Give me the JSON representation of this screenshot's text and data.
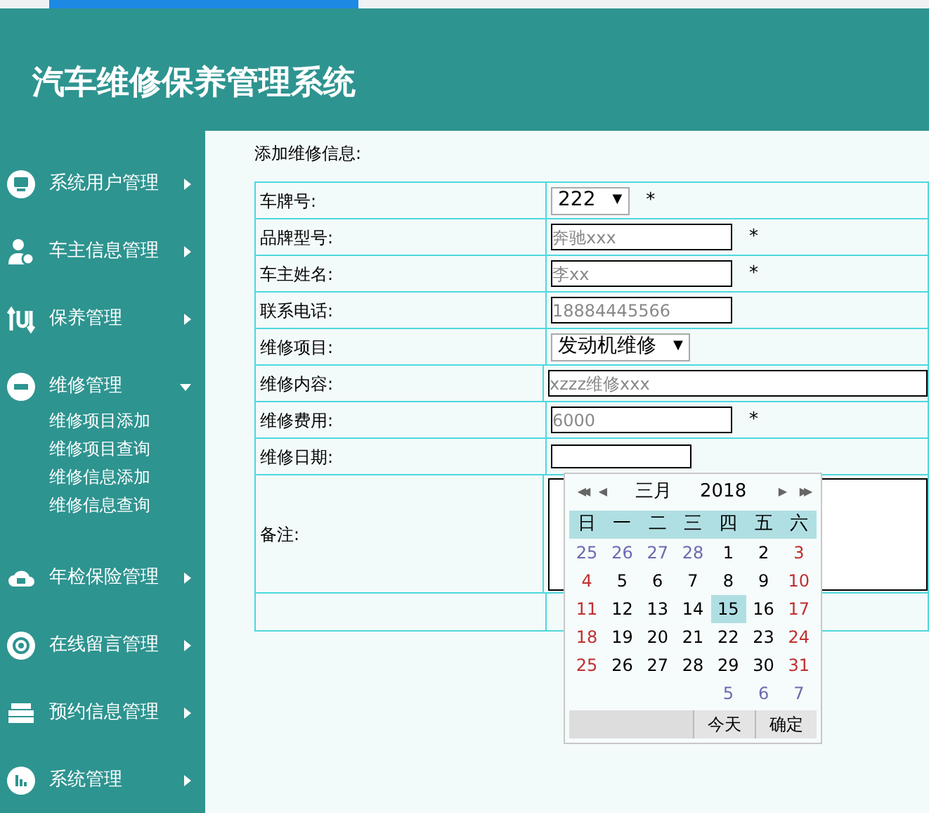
{
  "header": {
    "title": "汽车维修保养管理系统"
  },
  "sidebar": {
    "items": [
      {
        "label": "系统用户管理",
        "expanded": false
      },
      {
        "label": "车主信息管理",
        "expanded": false
      },
      {
        "label": "保养管理",
        "expanded": false
      },
      {
        "label": "维修管理",
        "expanded": true,
        "children": [
          {
            "label": "维修项目添加"
          },
          {
            "label": "维修项目查询"
          },
          {
            "label": "维修信息添加"
          },
          {
            "label": "维修信息查询"
          }
        ]
      },
      {
        "label": "年检保险管理",
        "expanded": false
      },
      {
        "label": "在线留言管理",
        "expanded": false
      },
      {
        "label": "预约信息管理",
        "expanded": false
      },
      {
        "label": "系统管理",
        "expanded": false
      }
    ]
  },
  "form": {
    "title": "添加维修信息:",
    "rows": [
      {
        "label": "车牌号:",
        "kind": "select",
        "value": "222",
        "arrow": "▼",
        "required_mark": "*"
      },
      {
        "label": "品牌型号:",
        "kind": "text",
        "placeholder": "奔驰xxx",
        "required_mark": "*"
      },
      {
        "label": "车主姓名:",
        "kind": "text",
        "placeholder": "李xx",
        "required_mark": "*"
      },
      {
        "label": "联系电话:",
        "kind": "text",
        "placeholder": "18884445566"
      },
      {
        "label": "维修项目:",
        "kind": "select",
        "value": "发动机维修",
        "arrow": "▼"
      },
      {
        "label": "维修内容:",
        "kind": "wide",
        "placeholder": "xzzz维修xxx"
      },
      {
        "label": "维修费用:",
        "kind": "text",
        "placeholder": "6000",
        "required_mark": "*"
      },
      {
        "label": "维修日期:",
        "kind": "date"
      },
      {
        "label": "备注:",
        "kind": "textarea"
      }
    ]
  },
  "calendar": {
    "month": "三月",
    "year": "2018",
    "prev_year": "◀◀",
    "prev_month": "◀",
    "next_month": "▶",
    "next_year": "▶▶",
    "weekdays": [
      "日",
      "一",
      "二",
      "三",
      "四",
      "五",
      "六"
    ],
    "weeks": [
      [
        {
          "day": "25",
          "other_month": true,
          "selected": false
        },
        {
          "day": "26",
          "other_month": true,
          "selected": false
        },
        {
          "day": "27",
          "other_month": true,
          "selected": false
        },
        {
          "day": "28",
          "other_month": true,
          "selected": false
        },
        {
          "day": "1",
          "other_month": false,
          "selected": false
        },
        {
          "day": "2",
          "other_month": false,
          "selected": false
        },
        {
          "day": "3",
          "other_month": false,
          "selected": false
        }
      ],
      [
        {
          "day": "4",
          "other_month": false,
          "selected": false
        },
        {
          "day": "5",
          "other_month": false,
          "selected": false
        },
        {
          "day": "6",
          "other_month": false,
          "selected": false
        },
        {
          "day": "7",
          "other_month": false,
          "selected": false
        },
        {
          "day": "8",
          "other_month": false,
          "selected": false
        },
        {
          "day": "9",
          "other_month": false,
          "selected": false
        },
        {
          "day": "10",
          "other_month": false,
          "selected": false
        }
      ],
      [
        {
          "day": "11",
          "other_month": false,
          "selected": false
        },
        {
          "day": "12",
          "other_month": false,
          "selected": false
        },
        {
          "day": "13",
          "other_month": false,
          "selected": false
        },
        {
          "day": "14",
          "other_month": false,
          "selected": false
        },
        {
          "day": "15",
          "other_month": false,
          "selected": true
        },
        {
          "day": "16",
          "other_month": false,
          "selected": false
        },
        {
          "day": "17",
          "other_month": false,
          "selected": false
        }
      ],
      [
        {
          "day": "18",
          "other_month": false,
          "selected": false
        },
        {
          "day": "19",
          "other_month": false,
          "selected": false
        },
        {
          "day": "20",
          "other_month": false,
          "selected": false
        },
        {
          "day": "21",
          "other_month": false,
          "selected": false
        },
        {
          "day": "22",
          "other_month": false,
          "selected": false
        },
        {
          "day": "23",
          "other_month": false,
          "selected": false
        },
        {
          "day": "24",
          "other_month": false,
          "selected": false
        }
      ],
      [
        {
          "day": "25",
          "other_month": false,
          "selected": false
        },
        {
          "day": "26",
          "other_month": false,
          "selected": false
        },
        {
          "day": "27",
          "other_month": false,
          "selected": false
        },
        {
          "day": "28",
          "other_month": false,
          "selected": false
        },
        {
          "day": "29",
          "other_month": false,
          "selected": false
        },
        {
          "day": "30",
          "other_month": false,
          "selected": false
        },
        {
          "day": "31",
          "other_month": false,
          "selected": false
        }
      ],
      [
        {
          "day": "5",
          "other_month": true,
          "selected": false
        },
        {
          "day": "6",
          "other_month": true,
          "selected": false
        },
        {
          "day": "7",
          "other_month": true,
          "selected": false
        }
      ]
    ],
    "buttons": [
      "今天",
      "确定"
    ]
  }
}
